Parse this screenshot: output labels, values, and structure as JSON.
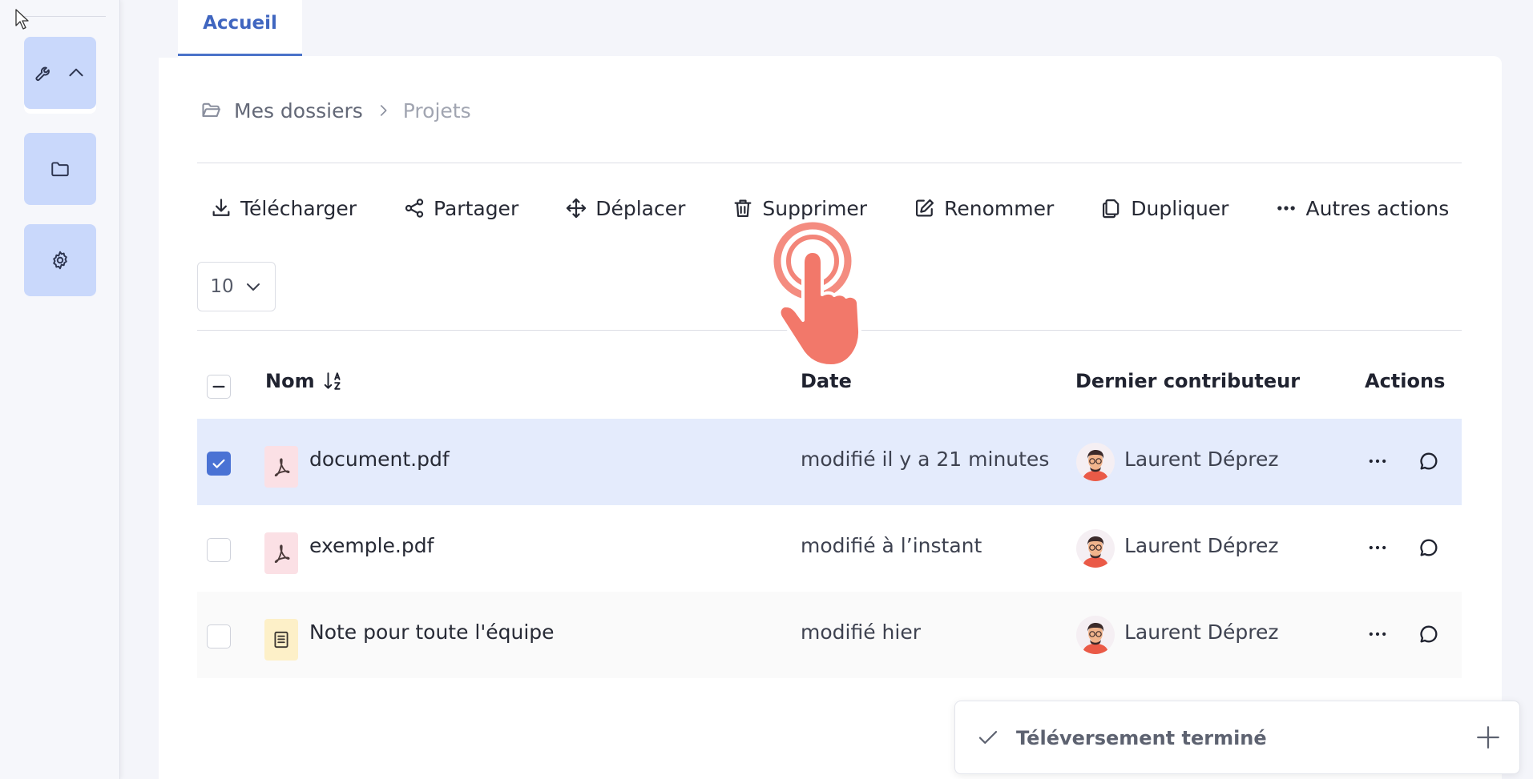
{
  "sidebar": {
    "items": [
      {
        "icon": "wrench-icon",
        "secondary_icon": "chevron-up-icon"
      },
      {
        "icon": "folder-icon"
      },
      {
        "icon": "gear-icon"
      }
    ]
  },
  "tabs": [
    {
      "label": "Accueil"
    }
  ],
  "breadcrumb": {
    "root": "Mes dossiers",
    "separator": ">",
    "current": "Projets"
  },
  "toolbar": {
    "download": "Télécharger",
    "share": "Partager",
    "move": "Déplacer",
    "delete": "Supprimer",
    "rename": "Renommer",
    "duplicate": "Dupliquer",
    "more": "Autres actions"
  },
  "page_size": {
    "value": "10"
  },
  "table": {
    "headers": {
      "name": "Nom",
      "date": "Date",
      "contributor": "Dernier contributeur",
      "actions": "Actions"
    },
    "rows": [
      {
        "name": "document.pdf",
        "type": "pdf",
        "date": "modifié il y a 21 minutes",
        "contributor": "Laurent Déprez",
        "selected": true
      },
      {
        "name": "exemple.pdf",
        "type": "pdf",
        "date": "modifié à l’instant",
        "contributor": "Laurent Déprez",
        "selected": false
      },
      {
        "name": "Note pour toute l'équipe",
        "type": "note",
        "date": "modifié hier",
        "contributor": "Laurent Déprez",
        "selected": false
      }
    ]
  },
  "toast": {
    "message": "Téléversement terminé"
  },
  "colors": {
    "accent": "#4066c0",
    "sidebar_button": "#c9d8fb",
    "selected_row": "#e4ebfc",
    "checkbox_checked": "#4a72d4",
    "pdf_icon_bg": "#fbe0e5",
    "note_icon_bg": "#fdf0c8",
    "click_hint": "#f2786a"
  }
}
